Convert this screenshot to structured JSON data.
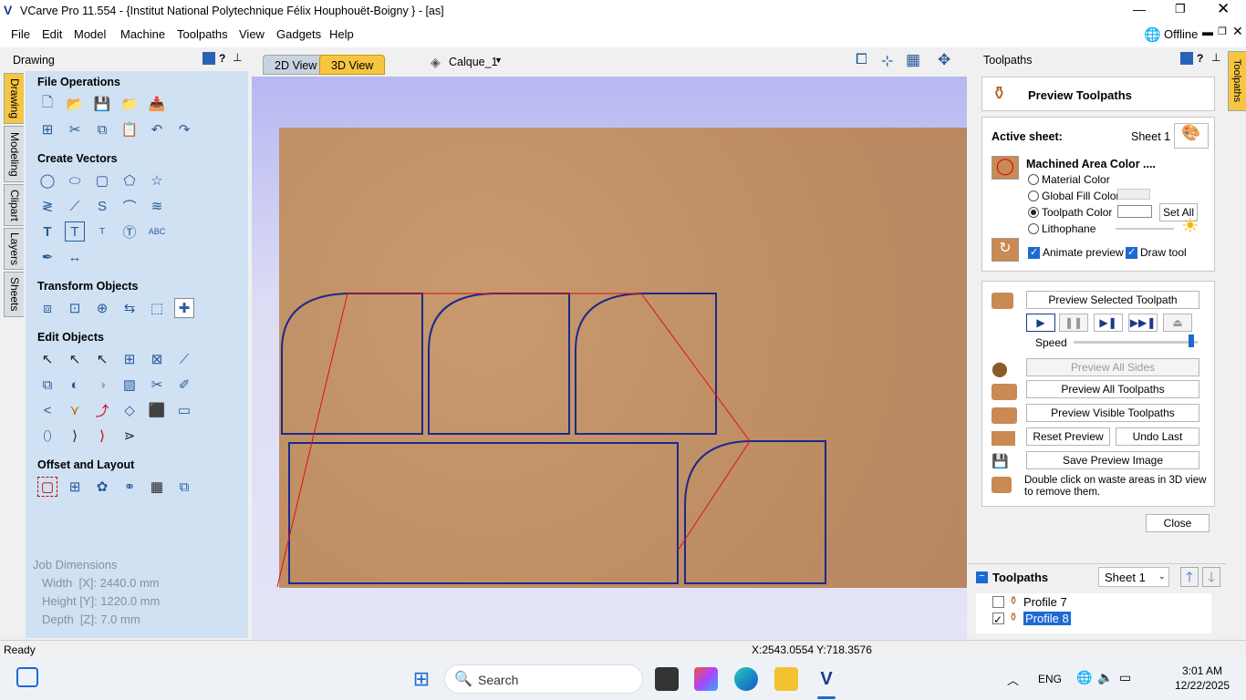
{
  "window": {
    "title": "VCarve Pro 11.554 - {Institut National Polytechnique Félix Houphouët-Boigny } - [as]"
  },
  "menu": [
    "File",
    "Edit",
    "Model",
    "Machine",
    "Toolpaths",
    "View",
    "Gadgets",
    "Help"
  ],
  "offline": "Offline",
  "left_panel": {
    "title": "Drawing",
    "tabs": [
      "Drawing",
      "Modeling",
      "Clipart",
      "Layers",
      "Sheets"
    ],
    "sections": {
      "file": "File Operations",
      "create": "Create Vectors",
      "transform": "Transform Objects",
      "edit": "Edit Objects",
      "offset": "Offset and Layout"
    },
    "job": {
      "title": "Job Dimensions",
      "width": "Width  [X]: 2440.0 mm",
      "height": "Height [Y]: 1220.0 mm",
      "depth": "Depth  [Z]: 7.0 mm"
    }
  },
  "view_tabs": {
    "tab2d": "2D View",
    "tab3d": "3D View",
    "layer": "Calque_1"
  },
  "right_panel": {
    "title": "Toolpaths",
    "side_tab": "Toolpaths",
    "preview_title": "Preview Toolpaths",
    "active_sheet_label": "Active sheet:",
    "active_sheet_value": "Sheet 1",
    "mac_title": "Machined Area Color ....",
    "material_color": "Material Color",
    "global_fill": "Global Fill Color",
    "toolpath_color": "Toolpath Color",
    "lithophane": "Lithophane",
    "set_all": "Set All",
    "animate_preview": "Animate preview",
    "draw_tool": "Draw tool",
    "preview_selected": "Preview Selected Toolpath",
    "speed": "Speed",
    "speed_level": 0.97,
    "preview_all_sides": "Preview All Sides",
    "preview_all_toolpaths": "Preview All Toolpaths",
    "preview_visible": "Preview Visible Toolpaths",
    "reset_preview": "Reset Preview",
    "undo_last": "Undo Last",
    "save_preview": "Save Preview Image",
    "hint": "Double click on waste areas in 3D view to remove them.",
    "close": "Close",
    "toolpaths_header": "Toolpaths",
    "sheet_select": "Sheet 1",
    "items": [
      {
        "name": "Profile 7",
        "checked": false
      },
      {
        "name": "Profile 8",
        "checked": true
      }
    ]
  },
  "status": {
    "ready": "Ready",
    "coords": "X:2543.0554 Y:718.3576"
  },
  "taskbar": {
    "search": "Search",
    "lang": "ENG",
    "time": "3:01 AM",
    "date": "12/22/2025"
  },
  "colors": {
    "accent": "#f6c542",
    "toolpath": "#1a2a8c",
    "rapid": "#e01010",
    "board": "#c08f64"
  }
}
